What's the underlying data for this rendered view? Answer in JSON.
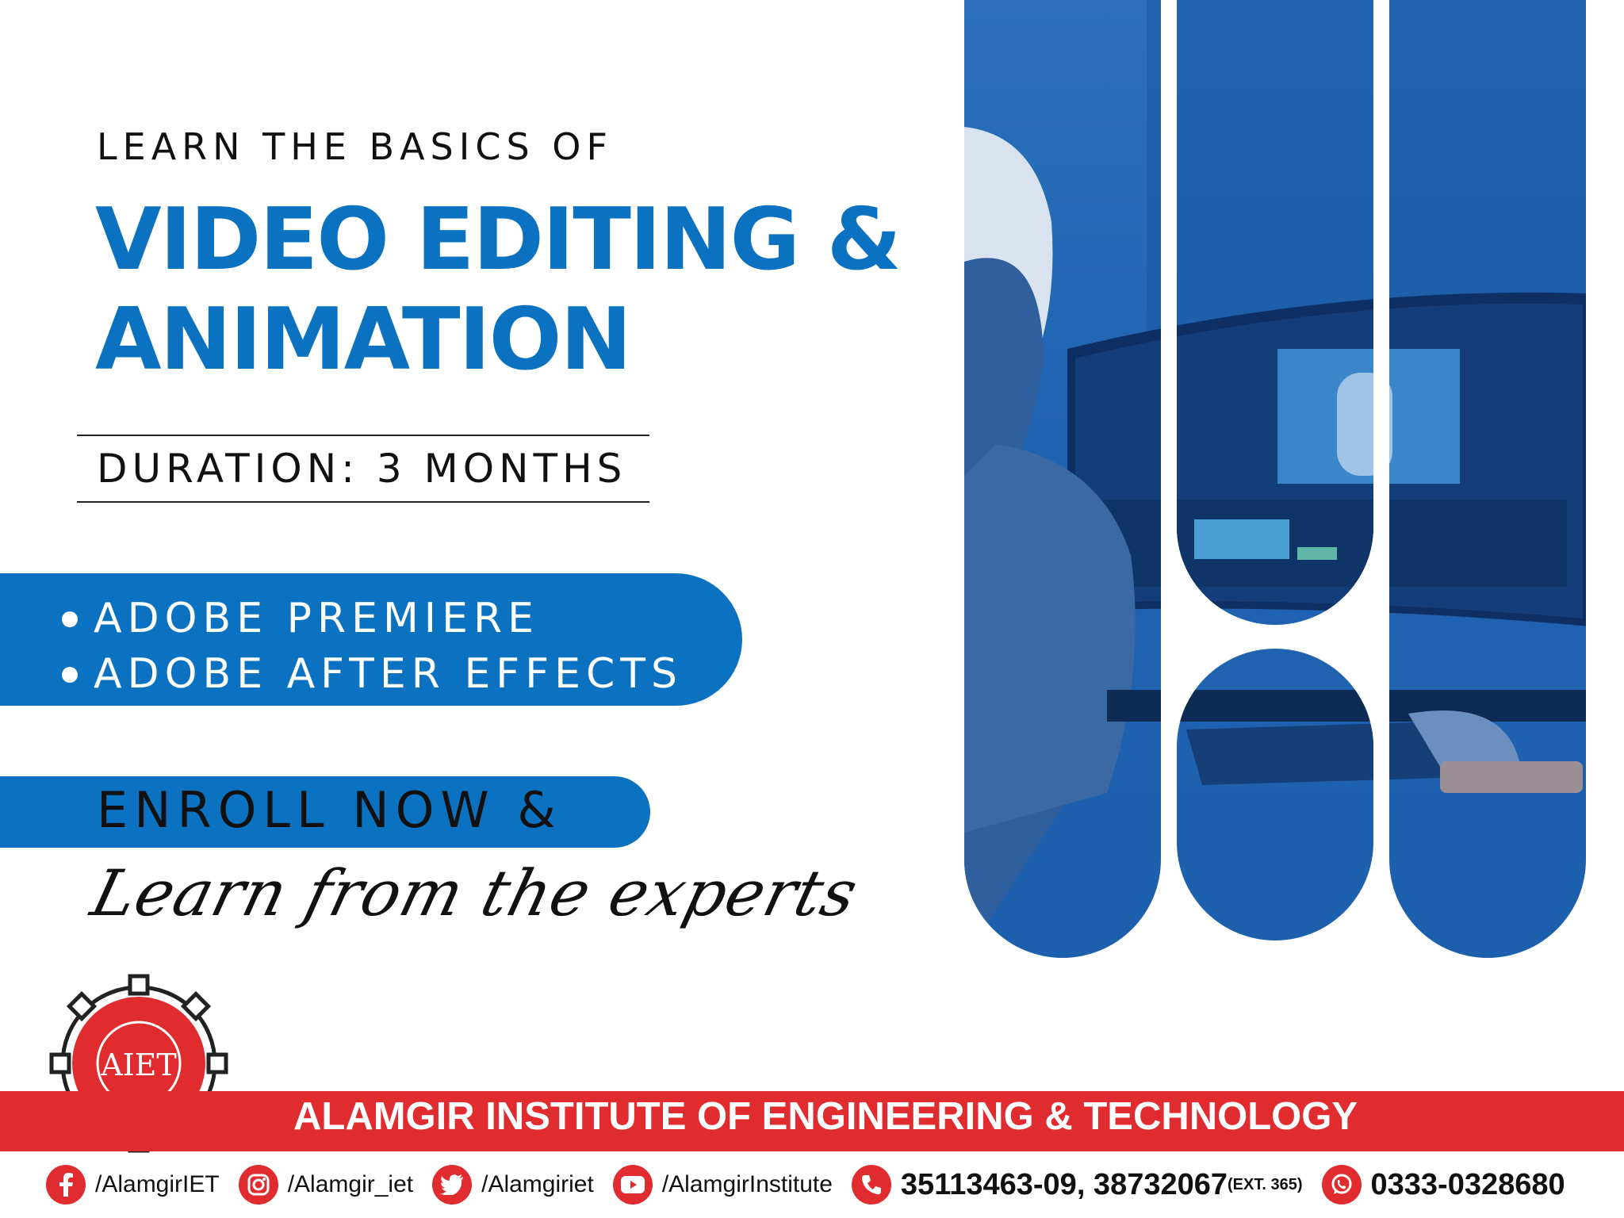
{
  "headline": {
    "kicker": "LEARN THE BASICS OF",
    "title_line1": "VIDEO EDITING &",
    "title_line2": "ANIMATION"
  },
  "duration": "DURATION: 3 MONTHS",
  "course_items": [
    "ADOBE PREMIERE",
    "ADOBE AFTER EFFECTS"
  ],
  "cta": {
    "enroll": "ENROLL NOW &",
    "tagline": "Learn from the experts"
  },
  "institute": {
    "name": "ALAMGIR INSTITUTE OF ENGINEERING & TECHNOLOGY",
    "logo_text": "AIET"
  },
  "social": {
    "facebook": "/AlamgirIET",
    "instagram": "/Alamgir_iet",
    "twitter": "/Alamgiriet",
    "youtube": "/AlamgirInstitute",
    "phone": "35113463-09, 38732067",
    "phone_ext": "(EXT. 365)",
    "whatsapp": "0333-0328680"
  },
  "colors": {
    "brand_blue": "#0b72c2",
    "brand_red": "#e02b2f"
  },
  "icons": [
    "facebook-icon",
    "instagram-icon",
    "twitter-icon",
    "youtube-icon",
    "phone-icon",
    "whatsapp-icon"
  ]
}
